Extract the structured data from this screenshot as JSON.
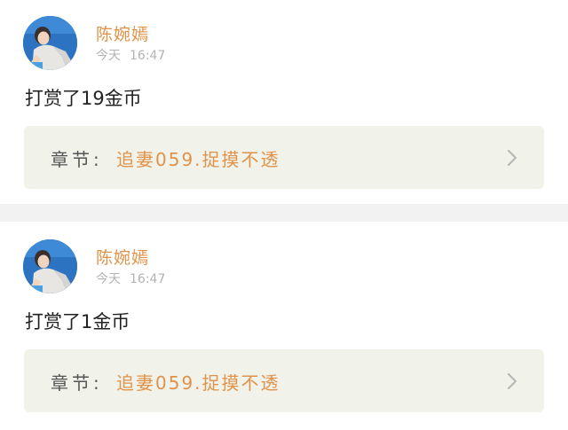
{
  "feed": {
    "items": [
      {
        "username": "陈婉嫣",
        "time_day": "今天",
        "time_clock": "16:47",
        "message": "打赏了19金币",
        "chapter_prefix": "章节:",
        "chapter_title": "追妻059.捉摸不透",
        "avatar_icon": "user-avatar-photo",
        "chevron_icon": "chevron-right-icon"
      },
      {
        "username": "陈婉嫣",
        "time_day": "今天",
        "time_clock": "16:47",
        "message": "打赏了1金币",
        "chapter_prefix": "章节:",
        "chapter_title": "追妻059.捉摸不透",
        "avatar_icon": "user-avatar-photo",
        "chevron_icon": "chevron-right-icon"
      }
    ]
  },
  "colors": {
    "username": "#e0924a",
    "chapter_title": "#e0924a",
    "chapter_box_bg": "#f1f3ea",
    "timestamp": "#b3b3b3",
    "separator": "#f2f2f2"
  }
}
